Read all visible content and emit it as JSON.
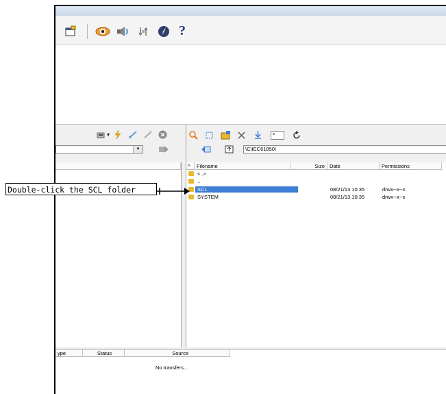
{
  "callout": {
    "text": "Double-click the SCL folder"
  },
  "toolbar": {
    "icons": [
      "terminal-icon",
      "eye-icon",
      "speaker-icon",
      "transfer-icon",
      "compass-icon",
      "help-icon"
    ],
    "help_glyph": "?"
  },
  "left_pane": {
    "path_value": "",
    "dropdown_glyph": "▾"
  },
  "right_pane": {
    "path_value": "\\C\\IEC61850\\",
    "filter_value": "*",
    "columns": [
      "Filename",
      "Size",
      "Date",
      "Permissions"
    ],
    "sort_glyph": "^",
    "rows": [
      {
        "name": "<..>",
        "size": "",
        "date": "",
        "permissions": ""
      },
      {
        "name": "..",
        "size": "",
        "date": "",
        "permissions": ""
      },
      {
        "name": "SCL",
        "size": "",
        "date": "08/21/13 10:35",
        "permissions": "drwx--x--x"
      },
      {
        "name": "SYSTEM",
        "size": "",
        "date": "08/21/13 10:35",
        "permissions": "drwx--x--x"
      }
    ]
  },
  "transfers": {
    "columns": [
      "ype",
      "Status",
      "Source"
    ],
    "empty_text": "No transfers..."
  },
  "colors": {
    "selection": "#3d7fd4",
    "folder": "#e8b830",
    "accent_blue": "#1e3a8a"
  }
}
